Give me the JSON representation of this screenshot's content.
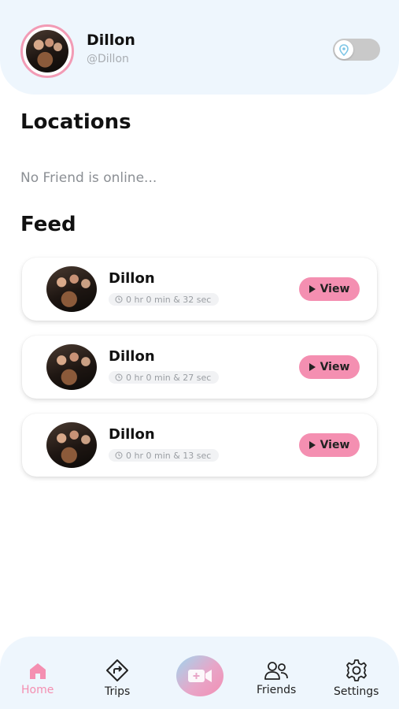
{
  "profile": {
    "name": "Dillon",
    "handle": "@Dillon",
    "location_sharing": false
  },
  "locations": {
    "title": "Locations",
    "empty_message": "No Friend is online..."
  },
  "feed": {
    "title": "Feed",
    "items": [
      {
        "name": "Dillon",
        "duration": "0 hr 0 min & 32 sec",
        "action": "View"
      },
      {
        "name": "Dillon",
        "duration": "0 hr 0 min & 27 sec",
        "action": "View"
      },
      {
        "name": "Dillon",
        "duration": "0 hr 0 min & 13 sec",
        "action": "View"
      }
    ]
  },
  "nav": {
    "items": [
      {
        "label": "Home",
        "icon": "home-icon",
        "active": true
      },
      {
        "label": "Trips",
        "icon": "directions-icon",
        "active": false
      },
      {
        "label": "",
        "icon": "video-plus-icon",
        "active": false
      },
      {
        "label": "Friends",
        "icon": "friends-icon",
        "active": false
      },
      {
        "label": "Settings",
        "icon": "gear-icon",
        "active": false
      }
    ]
  },
  "colors": {
    "accent_pink": "#f48fb1",
    "header_bg": "#eef6fd",
    "toggle_off": "#c9c9c9",
    "pin_blue": "#7ec6e6"
  }
}
